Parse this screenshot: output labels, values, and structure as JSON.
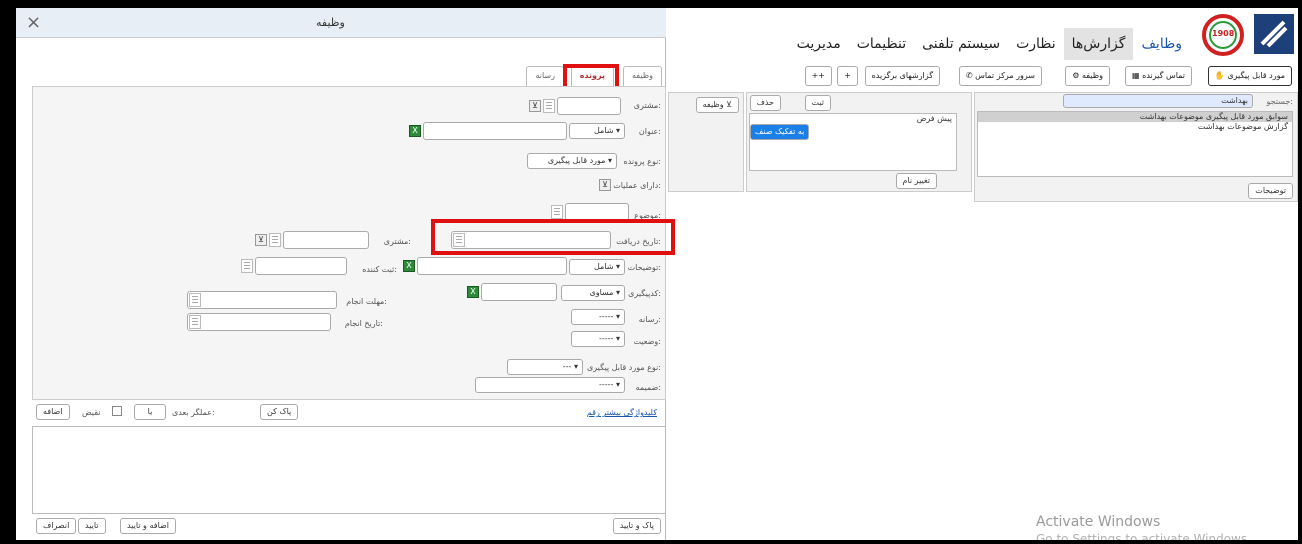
{
  "app": {
    "menu": [
      "وظایف",
      "گزارش‌ها",
      "نظارت",
      "سیستم تلفنی",
      "تنظیمات",
      "مدیریت"
    ],
    "logo_text": "1908"
  },
  "toolbar": {
    "followup_item": "مورد قابل پیگیری",
    "recipient_contact": "تماس گیرنده",
    "task": "وظیفه",
    "call_center_server": "سرور مرکز تماس",
    "favorite_reports": "گزارشهای برگزیده",
    "plus": "+",
    "plusplus": "++"
  },
  "search": {
    "label": "جستجو:",
    "value": "بهداشت",
    "results": [
      "سوابق مورد قابل پیگیری موضوعات بهداشت",
      "گزارش موضوعات بهداشت"
    ],
    "description_button": "توضیحات"
  },
  "middle": {
    "register_button": "ثبت",
    "delete_button": "حذف",
    "items": [
      "پیش فرض",
      "به تفکیک صنف"
    ],
    "rename_button": "تغییر نام",
    "task_filter": "وظیفه"
  },
  "dialog": {
    "title": "وظیفه",
    "tabs": [
      "وظیفه",
      "پرونده",
      "رسانه"
    ],
    "fields": {
      "customer": "مشتری:",
      "title": "عنوان:",
      "includes": "شامل",
      "case_type": "نوع پرونده:",
      "case_type_value": "مورد قابل پیگیری",
      "has_operations": "دارای عملیات:",
      "subject": "موضوع:",
      "customer2": "مشتری:",
      "receive_date": "تاریخ دریافت:",
      "description": "توضیحات:",
      "includes2": "شامل",
      "registrar": "ثبت کننده:",
      "coding": "کدپیگیری:",
      "equal": "مساوی",
      "deadline": "مهلت انجام:",
      "media": "رسانه:",
      "media_value": "-----",
      "done_date": "تاریخ انجام:",
      "status": "وضعیت:",
      "status_value": "-----",
      "followup_type": "نوع مورد قابل پیگیری:",
      "followup_type_value": "---",
      "attachment": "ضمیمه:",
      "attachment_value": "-----"
    },
    "link": "کلیدواژگی بیشتر رقم",
    "clear_button": "پاک کن",
    "next_operator": "عملگر بعدی:",
    "or_value": "یا",
    "negation": "نقیض",
    "add_button": "اضافه",
    "clear_confirm": "پاک و تایید",
    "add_confirm": "اضافه و تایید",
    "confirm": "تایید",
    "cancel": "انصراف"
  },
  "watermark": {
    "line1": "Activate Windows",
    "line2": "Go to Settings to activate Windows."
  }
}
